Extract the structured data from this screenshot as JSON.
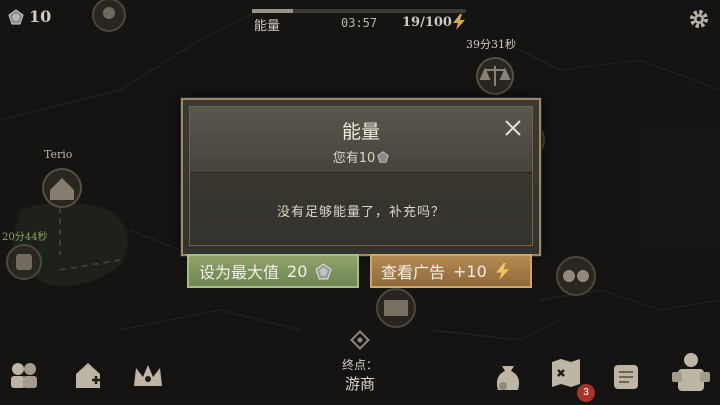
{
  "hud": {
    "gems": "10",
    "energy_label": "能量",
    "energy_timer": "03:57",
    "energy_count": "19/100",
    "energy_fill_fraction": 0.19,
    "icons": {
      "gem": "gem-icon",
      "bolt": "lightning-bolt-icon",
      "settings": "gear-icon"
    }
  },
  "map": {
    "timer_top_right": "39分31秒",
    "location_name": "Terio",
    "timer_left": "20分44秒",
    "nodes": [
      "skull-node-icon",
      "scales-node-icon",
      "house-node-icon",
      "guard-node-icon",
      "shop-node-icon",
      "skulls-node-icon"
    ]
  },
  "dialog": {
    "title": "能量",
    "subtitle": "您有10",
    "message": "没有足够能量了，补充吗？",
    "close_icon": "close-icon"
  },
  "buttons": {
    "max": {
      "label": "设为最大值",
      "cost": "20"
    },
    "ad": {
      "label": "查看广告",
      "reward": "+10"
    }
  },
  "bottom": {
    "destination_label": "终点：",
    "destination_name": "游商",
    "mail_badge": "3",
    "icons": [
      "party-icon",
      "build-icon",
      "crown-icon",
      "loot-bag-icon",
      "map-icon",
      "scroll-icon",
      "inventory-icon"
    ]
  },
  "colors": {
    "background": "#1b1a18",
    "dialog_border": "#9a8a6a",
    "max_button": "#8fa36a",
    "ad_button": "#b48a52",
    "badge": "#a8332c"
  }
}
